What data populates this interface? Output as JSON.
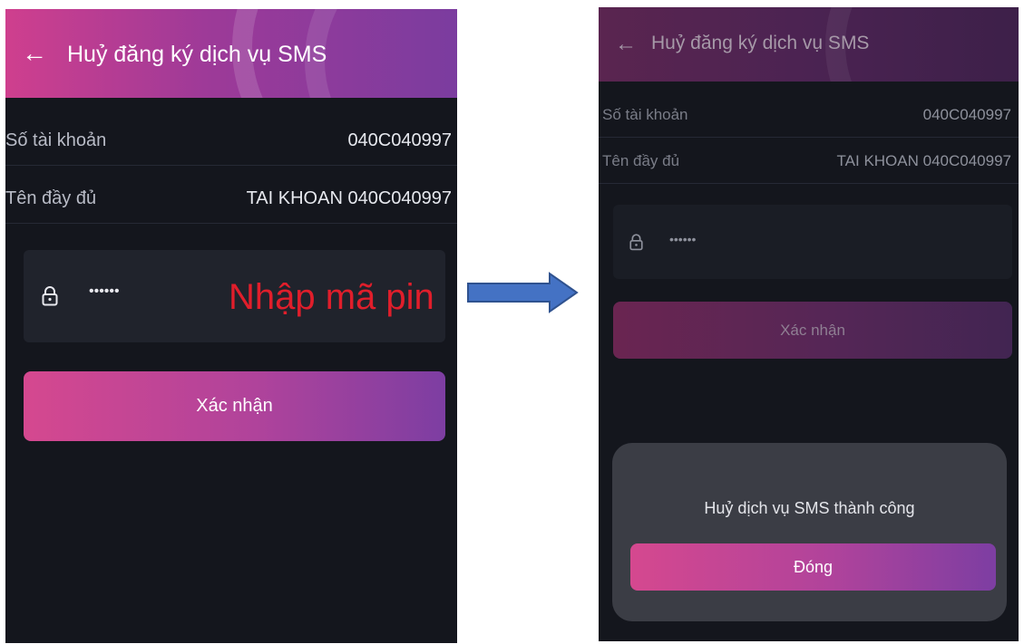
{
  "left_screen": {
    "header": {
      "back_icon": "arrow-left-icon",
      "title": "Huỷ đăng ký dịch vụ SMS"
    },
    "account_number": {
      "label": "Số tài khoản",
      "value": "040C040997"
    },
    "full_name": {
      "label": "Tên đầy đủ",
      "value": "TAI KHOAN 040C040997"
    },
    "pin": {
      "icon": "lock-icon",
      "masked_value": "••••••",
      "hint": "Nhập mã pin"
    },
    "confirm_button": {
      "label": "Xác nhận"
    }
  },
  "right_screen": {
    "header": {
      "back_icon": "arrow-left-icon",
      "title": "Huỷ đăng ký dịch vụ SMS"
    },
    "account_number": {
      "label": "Số tài khoản",
      "value": "040C040997"
    },
    "full_name": {
      "label": "Tên đầy đủ",
      "value": "TAI KHOAN 040C040997"
    },
    "pin": {
      "icon": "lock-icon",
      "masked_value": "••••••"
    },
    "confirm_button": {
      "label": "Xác nhận"
    },
    "dialog": {
      "message": "Huỷ dịch vụ SMS thành công",
      "close_button": "Đóng"
    }
  },
  "flow_arrow": {
    "icon": "right-arrow-icon",
    "color": "#4472c4"
  },
  "colors": {
    "accent_pink": "#d5488f",
    "accent_purple": "#7d3ea2",
    "background": "#14161d",
    "hint_red": "#e01e2b"
  }
}
